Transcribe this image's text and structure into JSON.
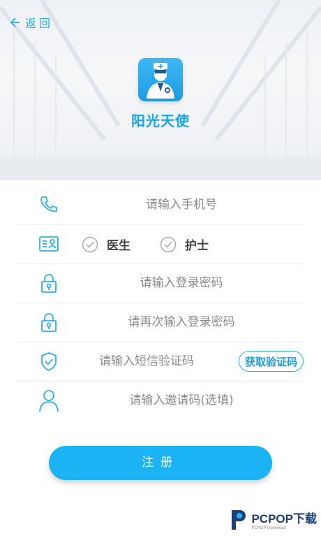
{
  "nav": {
    "back_label": "返回"
  },
  "app": {
    "name": "阳光天使"
  },
  "form": {
    "phone_placeholder": "请输入手机号",
    "roles": [
      {
        "label": "医生",
        "checked": false
      },
      {
        "label": "护士",
        "checked": false
      }
    ],
    "password_placeholder": "请输入登录密码",
    "confirm_password_placeholder": "请再次输入登录密码",
    "sms_code_placeholder": "请输入短信验证码",
    "get_code_label": "获取验证码",
    "invite_code_placeholder": "请输入邀请码(选填)"
  },
  "register_label": "注册",
  "watermark": {
    "brand": "PCPOP下载",
    "sub": "PCPOP Download"
  },
  "colors": {
    "accent": "#1cb3f4",
    "icon": "#2ab0f0"
  }
}
